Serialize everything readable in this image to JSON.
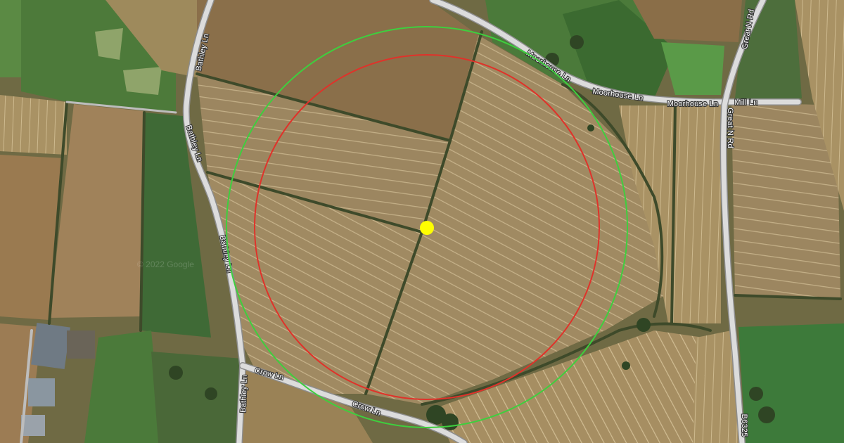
{
  "map": {
    "type": "satellite",
    "watermark": "© 2022 Google",
    "road_labels": {
      "bathley_1": "Bathley Ln",
      "bathley_2": "Bathley Ln",
      "bathley_3": "Bathley Ln",
      "bathley_4": "Bathley Ln",
      "moorhouse_1": "Moorhouse Ln",
      "moorhouse_2": "Moorhouse Ln",
      "moorhouse_3": "Moorhouse Ln",
      "mill": "Mill Ln",
      "great_n_1": "Great N Rd",
      "great_n_2": "Great N Rd",
      "crow_1": "Crow Ln",
      "crow_2": "Crow Ln",
      "b6325": "B6325"
    },
    "overlay": {
      "outer_circle_color": "#3ecf3e",
      "inner_circle_color": "#e0322a",
      "center_marker_color": "#ffff00"
    }
  }
}
